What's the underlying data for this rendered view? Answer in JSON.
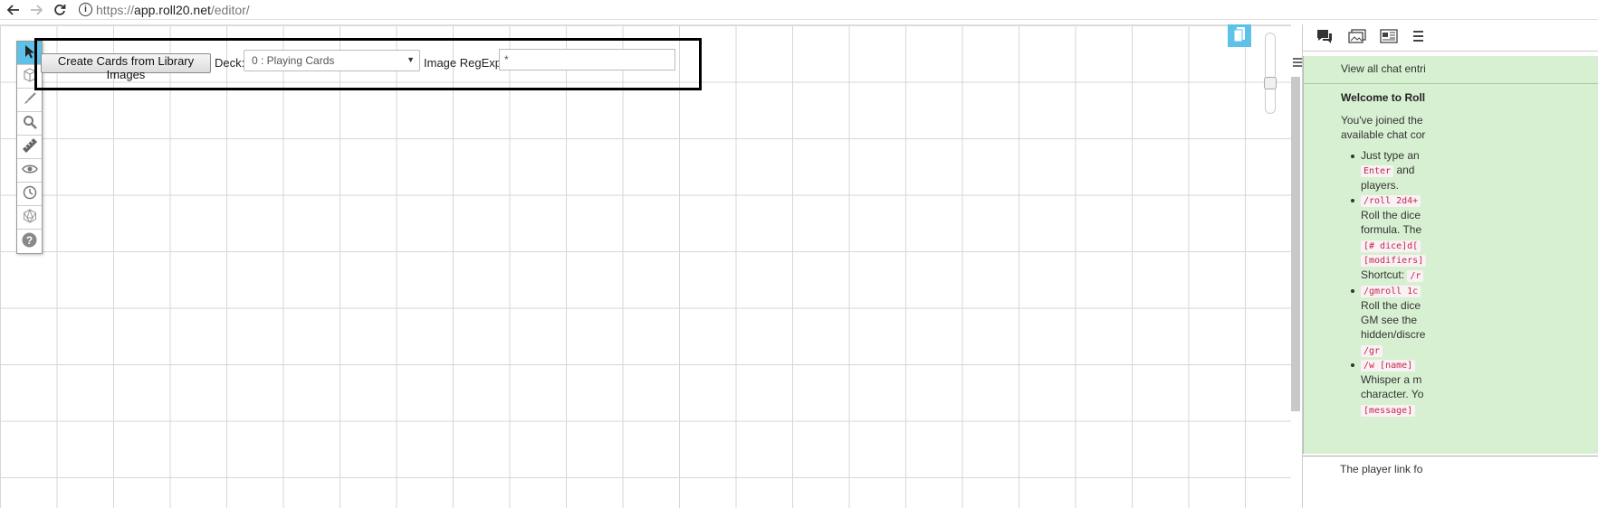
{
  "browser": {
    "url_protocol": "https://",
    "url_host": "app.roll20.net",
    "url_path": "/editor/",
    "info_icon": "i"
  },
  "toolbar": {
    "tools": [
      {
        "name": "select-icon",
        "active": true
      },
      {
        "name": "cube-icon",
        "active": false
      },
      {
        "name": "brush-icon",
        "active": false
      },
      {
        "name": "zoom-icon",
        "active": false
      },
      {
        "name": "ruler-icon",
        "active": false
      },
      {
        "name": "eye-icon",
        "active": false
      },
      {
        "name": "clock-icon",
        "active": false
      },
      {
        "name": "d20-icon",
        "active": false
      },
      {
        "name": "help-icon",
        "active": false
      }
    ]
  },
  "form": {
    "create_button": "Create Cards from Library Images",
    "deck_label": "Deck:",
    "deck_selected": "0 : Playing Cards",
    "regexp_label": "Image RegExp:",
    "regexp_value": "*"
  },
  "chat": {
    "view_all": "View all chat entri",
    "welcome": "Welcome to Roll",
    "intro_1": "You've joined the",
    "intro_2": "available chat cor",
    "b1_l1": "Just type an",
    "b1_l2_code": "Enter",
    "b1_l2_text": " and",
    "b1_l3": "players.",
    "b2_l1_code": "/roll 2d4+",
    "b2_l2": "Roll the dice",
    "b2_l3": "formula. The",
    "b2_l4_code": "[# dice]d[",
    "b2_l5_code": "[modifiers]",
    "b2_l6_text": "Shortcut: ",
    "b2_l6_code": "/r",
    "b3_l1_code": "/gmroll 1c",
    "b3_l2": "Roll the dice",
    "b3_l3": "GM see the",
    "b3_l4": "hidden/discre",
    "b3_l5_code": "/gr",
    "b4_l1_code": "/w [name]",
    "b4_l2": "Whisper a m",
    "b4_l3": "character. Yo",
    "b4_l4_code": "[message]",
    "player_link": "The player link fo"
  },
  "colors": {
    "accent": "#5ec1e8",
    "chat_bg": "#d8f0d2",
    "code_text": "#c7254e"
  }
}
